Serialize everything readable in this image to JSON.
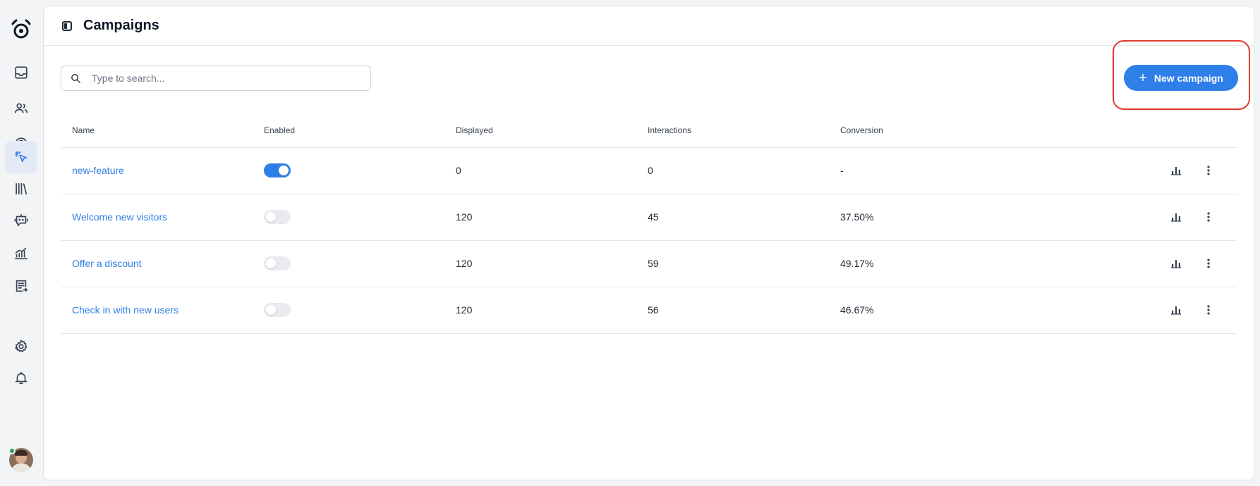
{
  "app": {
    "accent_color": "#2f7fe8"
  },
  "sidebar": {
    "items": [
      {
        "icon": "inbox-icon"
      },
      {
        "icon": "contacts-icon"
      },
      {
        "icon": "user-circle-icon"
      },
      {
        "icon": "campaigns-cursor-icon",
        "active": true
      },
      {
        "icon": "library-icon"
      },
      {
        "icon": "bot-icon"
      },
      {
        "icon": "reports-icon"
      },
      {
        "icon": "forms-icon"
      }
    ],
    "bottom": [
      {
        "icon": "gear-icon"
      },
      {
        "icon": "bell-icon"
      }
    ]
  },
  "header": {
    "title": "Campaigns"
  },
  "search": {
    "placeholder": "Type to search..."
  },
  "toolbar": {
    "new_campaign_label": "New campaign"
  },
  "table": {
    "columns": [
      "Name",
      "Enabled",
      "Displayed",
      "Interactions",
      "Conversion"
    ],
    "rows": [
      {
        "name": "new-feature",
        "enabled": true,
        "displayed": "0",
        "interactions": "0",
        "conversion": "-"
      },
      {
        "name": "Welcome new visitors",
        "enabled": false,
        "displayed": "120",
        "interactions": "45",
        "conversion": "37.50%"
      },
      {
        "name": "Offer a discount",
        "enabled": false,
        "displayed": "120",
        "interactions": "59",
        "conversion": "49.17%"
      },
      {
        "name": "Check in with new users",
        "enabled": false,
        "displayed": "120",
        "interactions": "56",
        "conversion": "46.67%"
      }
    ]
  }
}
